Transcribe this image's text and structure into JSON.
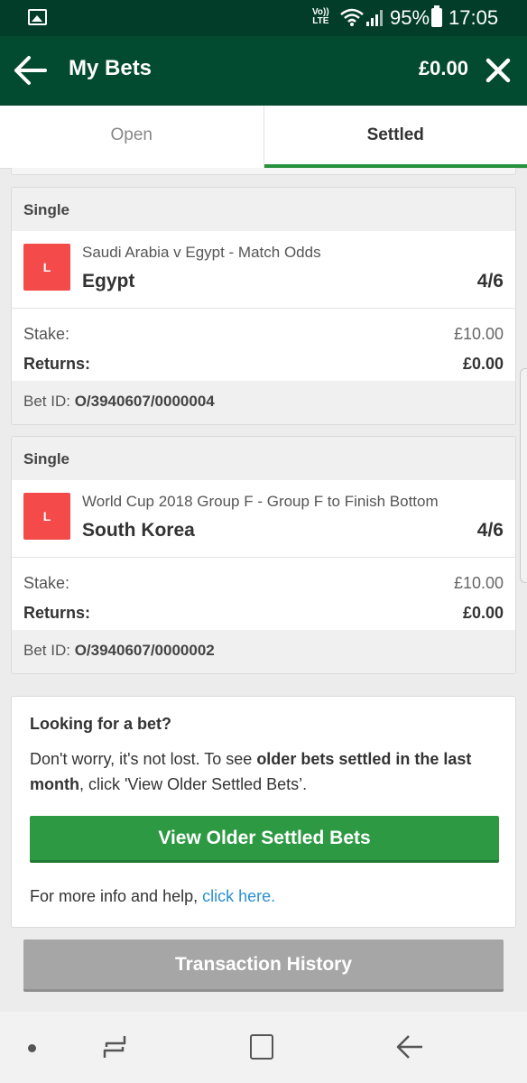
{
  "status_bar": {
    "volte_line1": "Vo))",
    "volte_line2": "LTE",
    "battery": "95%",
    "time": "17:05",
    "icons": [
      "image-icon",
      "volte-icon",
      "wifi-icon",
      "signal-icon",
      "battery-icon"
    ]
  },
  "header": {
    "title": "My Bets",
    "balance": "£0.00",
    "back_icon": "arrow-left-icon",
    "close_icon": "close-icon"
  },
  "tabs": [
    {
      "label": "Open",
      "active": false
    },
    {
      "label": "Settled",
      "active": true
    }
  ],
  "bets": [
    {
      "type": "Single",
      "result": "L",
      "market": "Saudi Arabia v Egypt - Match Odds",
      "selection": "Egypt",
      "odds": "4/6",
      "stake_label": "Stake:",
      "stake": "£10.00",
      "returns_label": "Returns:",
      "returns": "£0.00",
      "bet_id_label": "Bet ID:",
      "bet_id": "O/3940607/0000004"
    },
    {
      "type": "Single",
      "result": "L",
      "market": "World Cup 2018 Group F - Group F to Finish Bottom",
      "selection": "South Korea",
      "odds": "4/6",
      "stake_label": "Stake:",
      "stake": "£10.00",
      "returns_label": "Returns:",
      "returns": "£0.00",
      "bet_id_label": "Bet ID:",
      "bet_id": "O/3940607/0000002"
    }
  ],
  "help": {
    "heading": "Looking for a bet?",
    "text_before": "Don't worry, it's not lost. To see ",
    "text_bold": "older bets settled in the last month",
    "text_after": ", click 'View Older Settled Bets’.",
    "button": "View Older Settled Bets",
    "more_text": "For more info and help, ",
    "more_link": "click here."
  },
  "transaction_button": "Transaction History",
  "colors": {
    "status_bar": "#023d29",
    "header": "#024a30",
    "accent_green": "#2d9a43",
    "loss_badge": "#f44a4a",
    "link": "#2a8fd0",
    "disabled_button": "#a6a6a6"
  }
}
